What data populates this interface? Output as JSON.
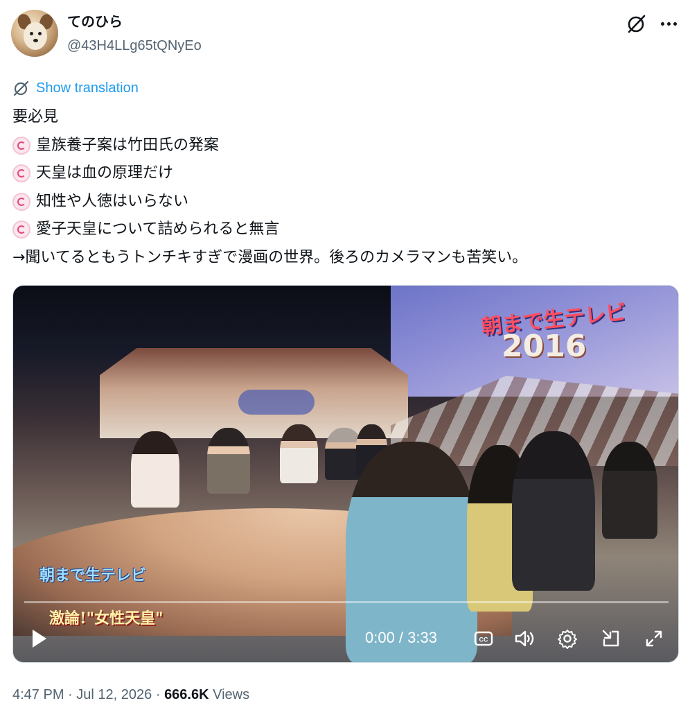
{
  "author": {
    "name": "てのひら",
    "handle": "@43H4LLg65tQNyEo"
  },
  "actions": {
    "grok_icon": "grok-icon",
    "more_icon": "more-horizontal-icon"
  },
  "translation": {
    "label": "Show translation",
    "icon": "translate-icon"
  },
  "tweet": {
    "lines": [
      "要必見",
      "皇族養子案は竹田氏の発案",
      "天皇は血の原理だけ",
      "知性や人徳はいらない",
      "愛子天皇について詰められると無言",
      "→聞いてるともうトンチキすぎで漫画の世界。後ろのカメラマンも苦笑い。"
    ],
    "bullet_icon": "swirl-emoji-icon"
  },
  "video": {
    "overlay": {
      "screen_logo": "朝まで生テレビ",
      "year": "2016",
      "caption_logo": "朝まで生テレビ",
      "caption_title": "激論!\"女性天皇\""
    },
    "time": "0:00 / 3:33",
    "progress": 0,
    "controls": [
      "play-icon",
      "captions-icon",
      "volume-icon",
      "settings-icon",
      "pip-icon",
      "fullscreen-icon"
    ]
  },
  "meta": {
    "time": "4:47 PM",
    "date": "Jul 12, 2026",
    "views_count": "666.6K",
    "views_label": "Views"
  },
  "colors": {
    "accent": "#1d9bf0",
    "text": "#0f1419",
    "secondary": "#536471"
  }
}
